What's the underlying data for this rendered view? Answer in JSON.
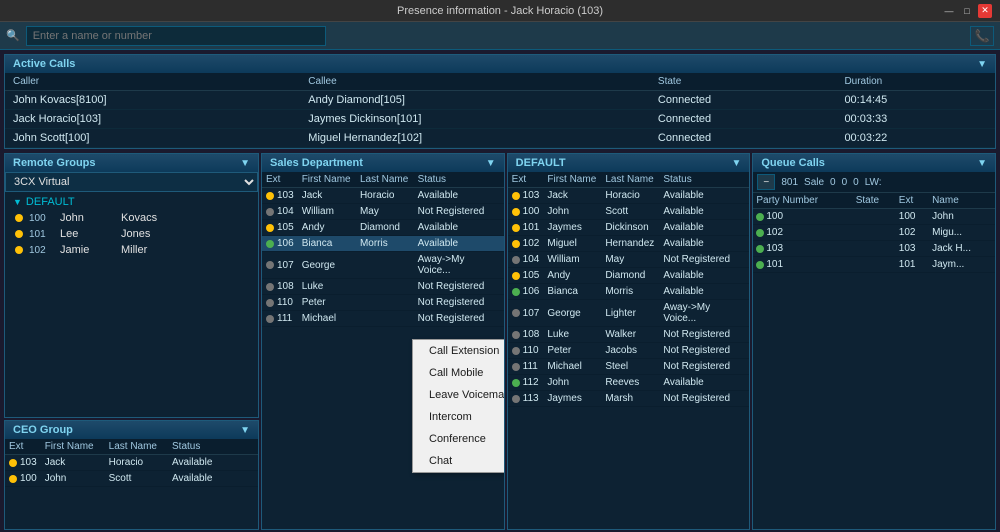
{
  "titleBar": {
    "title": "Presence information - Jack Horacio (103)",
    "minBtn": "—",
    "maxBtn": "□",
    "closeBtn": "✕"
  },
  "search": {
    "placeholder": "Enter a name or number"
  },
  "activeCalls": {
    "header": "Active Calls",
    "columns": [
      "Caller",
      "Callee",
      "State",
      "Duration"
    ],
    "rows": [
      {
        "caller": "John Kovacs[8100]",
        "callee": "Andy Diamond[105]",
        "state": "Connected",
        "duration": "00:14:45"
      },
      {
        "caller": "Jack Horacio[103]",
        "callee": "Jaymes Dickinson[101]",
        "state": "Connected",
        "duration": "00:03:33"
      },
      {
        "caller": "John Scott[100]",
        "callee": "Miguel Hernandez[102]",
        "state": "Connected",
        "duration": "00:03:22"
      }
    ]
  },
  "remoteGroups": {
    "header": "Remote Groups",
    "dropdown": "3CX Virtual",
    "defaultGroup": "DEFAULT",
    "contacts": [
      {
        "ext": "100",
        "fname": "John",
        "lname": "Kovacs",
        "status": "yellow"
      },
      {
        "ext": "101",
        "fname": "Lee",
        "lname": "Jones",
        "status": "yellow"
      },
      {
        "ext": "102",
        "fname": "Jamie",
        "lname": "Miller",
        "status": "yellow"
      }
    ]
  },
  "salesDept": {
    "header": "Sales Department",
    "columns": [
      "Ext",
      "First Name",
      "Last Name",
      "Status"
    ],
    "rows": [
      {
        "ext": "103",
        "fname": "Jack",
        "lname": "Horacio",
        "status": "Available",
        "dot": "yellow"
      },
      {
        "ext": "104",
        "fname": "William",
        "lname": "May",
        "status": "Not Registered",
        "dot": "gray"
      },
      {
        "ext": "105",
        "fname": "Andy",
        "lname": "Diamond",
        "status": "Available",
        "dot": "yellow"
      },
      {
        "ext": "106",
        "fname": "Bianca",
        "lname": "Morris",
        "status": "Available",
        "dot": "green",
        "selected": true
      },
      {
        "ext": "107",
        "fname": "George",
        "lname": "",
        "status": "Away->My Voice...",
        "dot": "gray"
      },
      {
        "ext": "108",
        "fname": "Luke",
        "lname": "",
        "status": "Not Registered",
        "dot": "gray"
      },
      {
        "ext": "110",
        "fname": "Peter",
        "lname": "",
        "status": "Not Registered",
        "dot": "gray"
      },
      {
        "ext": "111",
        "fname": "Michael",
        "lname": "",
        "status": "Not Registered",
        "dot": "gray"
      }
    ]
  },
  "contextMenu": {
    "items": [
      "Call Extension",
      "Call Mobile",
      "Leave Voicemail",
      "Intercom",
      "Conference",
      "Chat"
    ]
  },
  "defaultGroup": {
    "header": "DEFAULT",
    "columns": [
      "Ext",
      "First Name",
      "Last Name",
      "Status"
    ],
    "rows": [
      {
        "ext": "103",
        "fname": "Jack",
        "lname": "Horacio",
        "status": "Available",
        "dot": "yellow"
      },
      {
        "ext": "100",
        "fname": "John",
        "lname": "Scott",
        "status": "Available",
        "dot": "yellow"
      },
      {
        "ext": "101",
        "fname": "Jaymes",
        "lname": "Dickinson",
        "status": "Available",
        "dot": "yellow"
      },
      {
        "ext": "102",
        "fname": "Miguel",
        "lname": "Hernandez",
        "status": "Available",
        "dot": "yellow"
      },
      {
        "ext": "104",
        "fname": "William",
        "lname": "May",
        "status": "Not Registered",
        "dot": "gray"
      },
      {
        "ext": "105",
        "fname": "Andy",
        "lname": "Diamond",
        "status": "Available",
        "dot": "yellow"
      },
      {
        "ext": "106",
        "fname": "Bianca",
        "lname": "Morris",
        "status": "Available",
        "dot": "green"
      },
      {
        "ext": "107",
        "fname": "George",
        "lname": "Lighter",
        "status": "Away->My Voice...",
        "dot": "gray"
      },
      {
        "ext": "108",
        "fname": "Luke",
        "lname": "Walker",
        "status": "Not Registered",
        "dot": "gray"
      },
      {
        "ext": "110",
        "fname": "Peter",
        "lname": "Jacobs",
        "status": "Not Registered",
        "dot": "gray"
      },
      {
        "ext": "111",
        "fname": "Michael",
        "lname": "Steel",
        "status": "Not Registered",
        "dot": "gray"
      },
      {
        "ext": "112",
        "fname": "John",
        "lname": "Reeves",
        "status": "Available",
        "dot": "green"
      },
      {
        "ext": "113",
        "fname": "Jaymes",
        "lname": "Marsh",
        "status": "Not Registered",
        "dot": "gray"
      }
    ]
  },
  "queueCalls": {
    "header": "Queue Calls",
    "queueLabel": "801",
    "queueName": "Sale",
    "vals": [
      "0",
      "0",
      "0"
    ],
    "lw": "LW:",
    "columns": [
      "Party Number",
      "State",
      "Ext",
      "Name"
    ],
    "rows": [
      {
        "party": "100",
        "state": "",
        "ext": "100",
        "name": "John",
        "dot": "green"
      },
      {
        "party": "102",
        "state": "",
        "ext": "102",
        "name": "Migu...",
        "dot": "green"
      },
      {
        "party": "103",
        "state": "",
        "ext": "103",
        "name": "Jack H...",
        "dot": "green"
      },
      {
        "party": "101",
        "state": "",
        "ext": "101",
        "name": "Jaym...",
        "dot": "green"
      }
    ]
  },
  "ceoGroup": {
    "header": "CEO Group",
    "columns": [
      "Ext",
      "First Name",
      "Last Name",
      "Status"
    ],
    "rows": [
      {
        "ext": "103",
        "fname": "Jack",
        "lname": "Horacio",
        "status": "Available",
        "dot": "yellow"
      },
      {
        "ext": "100",
        "fname": "John",
        "lname": "Scott",
        "status": "Available",
        "dot": "yellow"
      }
    ]
  }
}
